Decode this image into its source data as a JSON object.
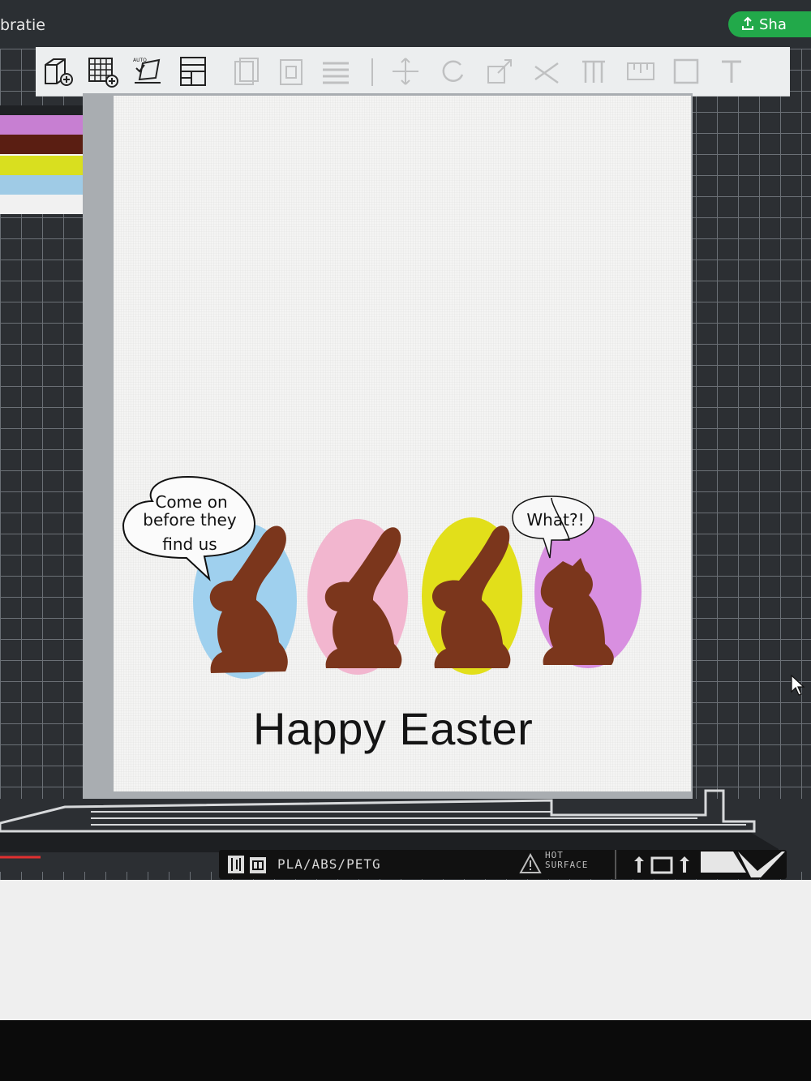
{
  "window": {
    "title": "bratie"
  },
  "header": {
    "share_label": "Sha",
    "share_color": "#22a94a"
  },
  "palette": {
    "swatches": [
      "#1f2124",
      "#c77fd2",
      "#5a1e12",
      "#f4f4f2",
      "#d9df1f",
      "#9fcbe6",
      "#f1f1f1"
    ]
  },
  "toolbar": {
    "tools": [
      {
        "icon": "add-cube-icon",
        "enabled": true
      },
      {
        "icon": "add-grid-icon",
        "enabled": true
      },
      {
        "icon": "auto-arrange-icon",
        "enabled": true,
        "label": "AUTO"
      },
      {
        "icon": "layout-icon",
        "enabled": true
      },
      {
        "icon": "copy-icon",
        "enabled": false
      },
      {
        "icon": "paste-icon",
        "enabled": false
      },
      {
        "icon": "layers-icon",
        "enabled": false
      }
    ]
  },
  "design": {
    "speech_bubble_left": [
      "Come on",
      "before they",
      "find us"
    ],
    "speech_bubble_right": "What?!",
    "greeting": "Happy Easter",
    "egg_colors": [
      "#9fd0ee",
      "#f2b6cf",
      "#e2df1a",
      "#d88fe0"
    ],
    "bunny_color": "#7b361c"
  },
  "plate": {
    "material": "PLA/ABS/PETG",
    "warning_line1": "HOT",
    "warning_line2": "SURFACE"
  }
}
